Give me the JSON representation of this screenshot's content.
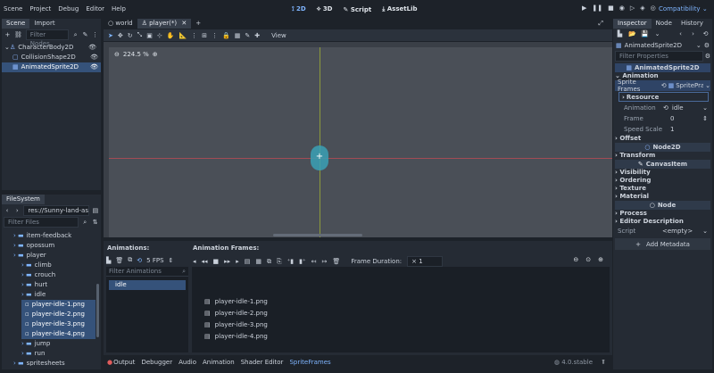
{
  "menu": [
    "Scene",
    "Project",
    "Debug",
    "Editor",
    "Help"
  ],
  "modes": [
    {
      "label": "2D",
      "icon": "2d-icon"
    },
    {
      "label": "3D",
      "icon": "3d-icon"
    },
    {
      "label": "Script",
      "icon": "script-icon"
    },
    {
      "label": "AssetLib",
      "icon": "assetlib-icon"
    }
  ],
  "renderer": "Compatibility",
  "scene_panel": {
    "tabs": [
      "Scene",
      "Import"
    ],
    "filter_placeholder": "Filter Nodes",
    "nodes": [
      "CharacterBody2D",
      "CollisionShape2D",
      "AnimatedSprite2D"
    ]
  },
  "filesystem": {
    "tab": "FileSystem",
    "path": "res://Sunny-land-assets-file",
    "filter_placeholder": "Filter Files",
    "items": [
      {
        "label": "item-feedback",
        "kind": "folder",
        "indent": 1
      },
      {
        "label": "opossum",
        "kind": "folder",
        "indent": 1
      },
      {
        "label": "player",
        "kind": "folder",
        "indent": 1
      },
      {
        "label": "climb",
        "kind": "folder",
        "indent": 2
      },
      {
        "label": "crouch",
        "kind": "folder",
        "indent": 2
      },
      {
        "label": "hurt",
        "kind": "folder",
        "indent": 2
      },
      {
        "label": "idle",
        "kind": "folder",
        "indent": 2
      },
      {
        "label": "player-idle-1.png",
        "kind": "file",
        "indent": 3
      },
      {
        "label": "player-idle-2.png",
        "kind": "file",
        "indent": 3
      },
      {
        "label": "player-idle-3.png",
        "kind": "file",
        "indent": 3
      },
      {
        "label": "player-idle-4.png",
        "kind": "file",
        "indent": 3
      },
      {
        "label": "jump",
        "kind": "folder",
        "indent": 2
      },
      {
        "label": "run",
        "kind": "folder",
        "indent": 2
      },
      {
        "label": "spritesheets",
        "kind": "folder",
        "indent": 1
      }
    ]
  },
  "editor_tabs": [
    "world",
    "player(*)"
  ],
  "viewport": {
    "zoom": "224.5 %",
    "view_label": "View"
  },
  "animations": {
    "title": "Animations:",
    "frames_title": "Animation Frames:",
    "fps": "5 FPS",
    "frame_duration_label": "Frame Duration:",
    "frame_duration_value": "1",
    "filter_placeholder": "Filter Animations",
    "list": [
      "idle"
    ],
    "frames": [
      "player-idle-1.png",
      "player-idle-2.png",
      "player-idle-3.png",
      "player-idle-4.png"
    ]
  },
  "bottom_tabs": [
    "Output",
    "Debugger",
    "Audio",
    "Animation",
    "Shader Editor",
    "SpriteFrames"
  ],
  "version": "4.0.stable",
  "inspector": {
    "tabs": [
      "Inspector",
      "Node",
      "History"
    ],
    "node_name": "AnimatedSprite2D",
    "filter_placeholder": "Filter Properties",
    "class_header": "AnimatedSprite2D",
    "sections": {
      "animation": "Animation",
      "offset": "Offset",
      "transform": "Transform",
      "visibility": "Visibility",
      "ordering": "Ordering",
      "texture": "Texture",
      "material": "Material",
      "process": "Process",
      "editor_description": "Editor Description"
    },
    "sprite_frames_label": "Sprite Frames",
    "sprite_frames_value": "SpritePra",
    "resource": "Resource",
    "props": [
      {
        "name": "Animation",
        "value": "idle"
      },
      {
        "name": "Frame",
        "value": "0"
      },
      {
        "name": "Speed Scale",
        "value": "1"
      }
    ],
    "class_node2d": "Node2D",
    "class_canvasitem": "CanvasItem",
    "class_node": "Node",
    "script_label": "Script",
    "script_value": "<empty>",
    "add_metadata": "Add Metadata"
  }
}
